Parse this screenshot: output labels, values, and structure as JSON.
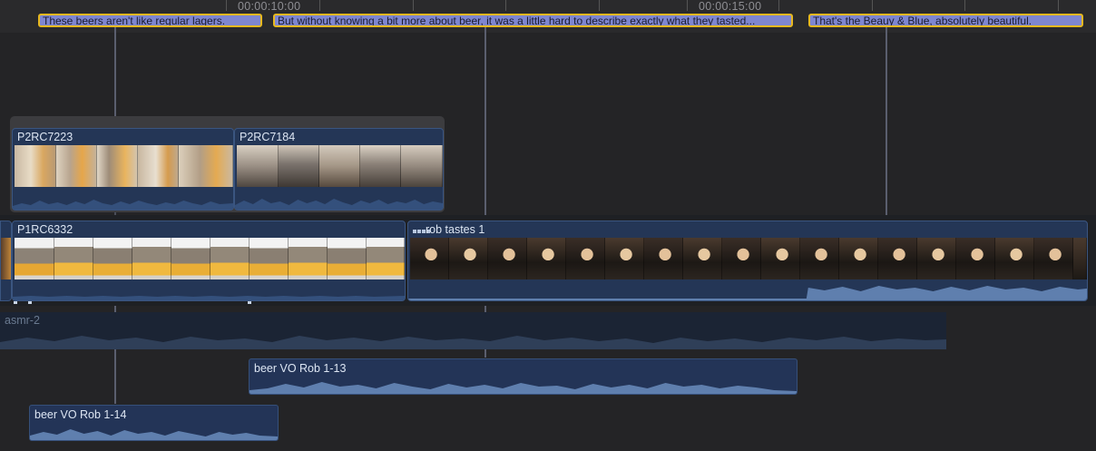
{
  "ruler": {
    "timecodes": [
      "00:00:10:00",
      "00:00:15:00"
    ]
  },
  "captions": [
    {
      "text": "These beers aren't like regular lagers."
    },
    {
      "text": "But without knowing a bit more about beer, it was a little hard to describe exactly what they tasted..."
    },
    {
      "text": "That's the Beauy & Blue, absolutely beautiful."
    }
  ],
  "connected_clips": [
    {
      "title": "P2RC7223"
    },
    {
      "title": "P2RC7184"
    }
  ],
  "primary_storyline": [
    {
      "title": "P1RC6332"
    },
    {
      "title": "rob tastes 1",
      "icon": "compound-clip-icon"
    }
  ],
  "audio_clips": [
    {
      "title": "asmr-2"
    },
    {
      "title": "beer VO Rob 1-13"
    },
    {
      "title": "beer VO Rob 1-14"
    }
  ],
  "colors": {
    "background": "#242426",
    "clip_blue": "#243656",
    "caption_fill": "#7e86d0",
    "caption_border": "#e8b91f",
    "waveform": "#5f7fae"
  }
}
